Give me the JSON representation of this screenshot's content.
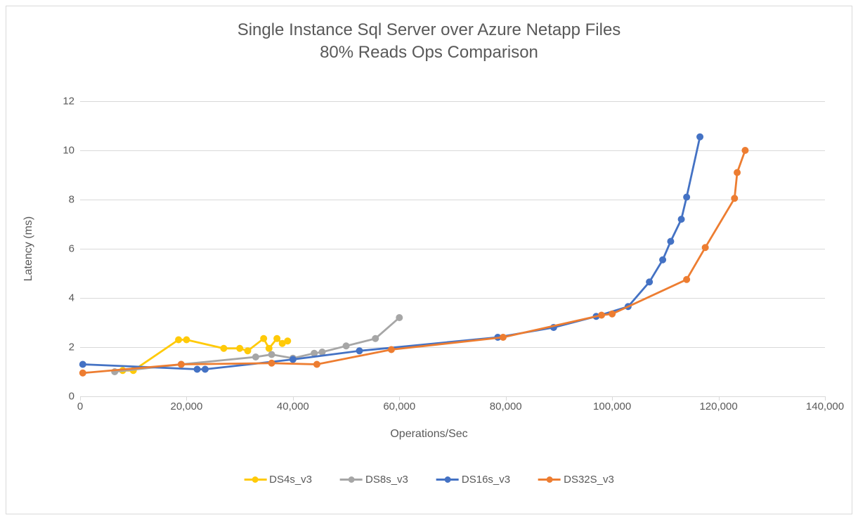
{
  "chart_data": {
    "type": "line",
    "title": "Single Instance Sql Server over Azure Netapp Files",
    "subtitle": "80% Reads Ops Comparison",
    "xlabel": "Operations/Sec",
    "ylabel": "Latency (ms)",
    "xlim": [
      0,
      140000
    ],
    "ylim": [
      0,
      12
    ],
    "x_ticks": [
      0,
      20000,
      40000,
      60000,
      80000,
      100000,
      120000,
      140000
    ],
    "x_tick_labels": [
      "0",
      "20,000",
      "40,000",
      "60,000",
      "80,000",
      "100,000",
      "120,000",
      "140,000"
    ],
    "y_ticks": [
      0,
      2,
      4,
      6,
      8,
      10,
      12
    ],
    "grid": "horizontal",
    "legend_position": "bottom",
    "series": [
      {
        "name": "DS4s_v3",
        "color": "#ffca08",
        "x": [
          8000,
          10000,
          18500,
          20000,
          27000,
          30000,
          31500,
          34500,
          35500,
          37000,
          38000,
          39000
        ],
        "y": [
          1.05,
          1.05,
          2.3,
          2.3,
          1.95,
          1.95,
          1.85,
          2.35,
          1.95,
          2.35,
          2.15,
          2.25
        ]
      },
      {
        "name": "DS8s_v3",
        "color": "#a6a6a6",
        "x": [
          6500,
          19000,
          33000,
          36000,
          40000,
          44000,
          45500,
          50000,
          55500,
          60000
        ],
        "y": [
          1.0,
          1.3,
          1.6,
          1.7,
          1.55,
          1.75,
          1.8,
          2.05,
          2.35,
          3.2
        ]
      },
      {
        "name": "DS16s_v3",
        "color": "#4472c4",
        "x": [
          500,
          22000,
          23500,
          40000,
          52500,
          78500,
          89000,
          97000,
          103000,
          107000,
          109500,
          111000,
          113000,
          114000,
          116500
        ],
        "y": [
          1.3,
          1.1,
          1.1,
          1.5,
          1.85,
          2.4,
          2.8,
          3.25,
          3.65,
          4.65,
          5.55,
          6.3,
          7.2,
          8.1,
          10.55
        ]
      },
      {
        "name": "DS32S_v3",
        "color": "#ed7d31",
        "x": [
          500,
          19000,
          36000,
          44500,
          58500,
          79500,
          98000,
          100000,
          114000,
          117500,
          123000,
          123500,
          125000
        ],
        "y": [
          0.95,
          1.3,
          1.35,
          1.3,
          1.9,
          2.4,
          3.3,
          3.35,
          4.75,
          6.05,
          8.05,
          9.1,
          10.0
        ]
      }
    ]
  }
}
